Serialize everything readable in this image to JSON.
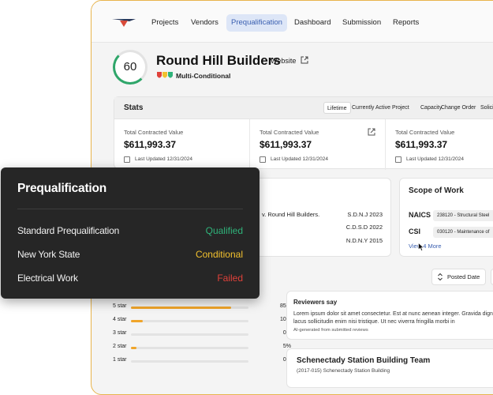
{
  "nav": {
    "items": [
      "Projects",
      "Vendors",
      "Prequalification",
      "Dashboard",
      "Submission",
      "Reports"
    ],
    "active": "Prequalification"
  },
  "header": {
    "score": "60",
    "title": "Round Hill Builders",
    "website": "Website",
    "status": "Multi-Conditional"
  },
  "stats": {
    "title": "Stats",
    "filters": [
      "Lifetime",
      "Currently Active Project",
      "Capacity",
      "Change Order",
      "Solicit"
    ],
    "cards": [
      {
        "label": "Total Contracted Value",
        "value": "$611,993.37",
        "updated": "Last Updated 12/31/2024"
      },
      {
        "label": "Total Contracted Value",
        "value": "$611,993.37",
        "updated": "Last Updated 12/31/2024"
      },
      {
        "label": "Total Contracted Value",
        "value": "$611,993.37",
        "updated": "Last Updated 12/31/2024"
      }
    ]
  },
  "litigation": {
    "case_text": "v. Round Hill Builders.",
    "courts": [
      "S.D.N.J 2023",
      "C.D.S.D 2022",
      "N.D.N.Y 2015"
    ]
  },
  "scope": {
    "title": "Scope of Work",
    "naics_label": "NAICS",
    "naics_value": "238120 - Structural Steel",
    "csi_label": "CSI",
    "csi_value": "030120 - Maintenance of",
    "view_more": "View 4 More"
  },
  "sort": {
    "label": "Posted Date"
  },
  "ratings": [
    {
      "label": "5 star",
      "percent": 85,
      "display": "85%"
    },
    {
      "label": "4 star",
      "percent": 10,
      "display": "10%"
    },
    {
      "label": "3 star",
      "percent": 0,
      "display": "0%"
    },
    {
      "label": "2 star",
      "percent": 5,
      "display": "5%"
    },
    {
      "label": "1 star",
      "percent": 0,
      "display": "0%"
    }
  ],
  "reviewers": {
    "title": "Reviewers say",
    "body": "Lorem ipsum dolor sit amet consectetur. Est at nunc aenean integer. Gravida dignissim lacus sollicitudin enim nisi tristique. Ut nec viverra fringilla morbi in",
    "note": "AI-generated from submitted reviews"
  },
  "team": {
    "title": "Schenectady Station Building Team",
    "subtitle": "(2017-015) Schenectady Station Building"
  },
  "popup": {
    "title": "Prequalification",
    "rows": [
      {
        "label": "Standard Prequalification",
        "status": "Qualified",
        "color": "#2fb37a"
      },
      {
        "label": "New York State",
        "status": "Conditional",
        "color": "#f2c12e"
      },
      {
        "label": "Electrical Work",
        "status": "Failed",
        "color": "#e0413a"
      }
    ]
  },
  "colors": {
    "accent_frame": "#e8b44c",
    "nav_active_bg": "#dde6f7",
    "nav_active_text": "#3a5fb0",
    "rating_fill": "#f0a52a"
  }
}
